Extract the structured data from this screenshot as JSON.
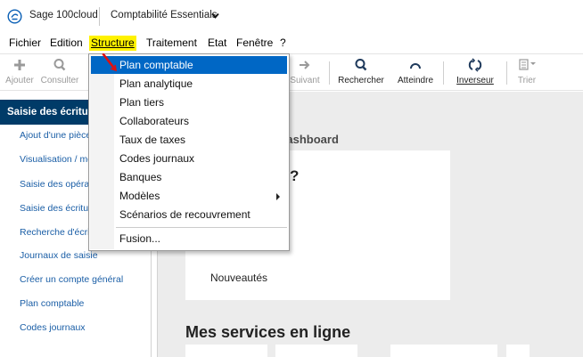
{
  "titlebar": {
    "app_name": "Sage 100cloud",
    "product": "Comptabilité Essentials",
    "logo_icon": "sage-logo-icon",
    "chevron_icon": "chevron-down-icon"
  },
  "menubar": {
    "items": [
      "Fichier",
      "Edition",
      "Structure",
      "Traitement",
      "Etat",
      "Fenêtre",
      "?"
    ],
    "active": "Structure",
    "active_color": "#fff200"
  },
  "toolbar": {
    "buttons": [
      {
        "label": "Ajouter",
        "icon": "plus-icon",
        "enabled": false
      },
      {
        "label": "Consulter",
        "icon": "search-icon",
        "enabled": false
      },
      {
        "label": "Suivant",
        "icon": "arrow-right-icon",
        "enabled": false
      },
      {
        "label": "Rechercher",
        "icon": "search-icon",
        "enabled": true
      },
      {
        "label": "Atteindre",
        "icon": "goto-icon",
        "enabled": true
      },
      {
        "label": "Inverseur",
        "icon": "refresh-icon",
        "enabled": true
      },
      {
        "label": "Trier",
        "icon": "sort-icon",
        "enabled": false
      }
    ]
  },
  "sidebar": {
    "header": "Saisie des écritures",
    "header_color": "#003b68",
    "links": [
      "Ajout d'une pièce",
      "Visualisation / modification",
      "Saisie des opérations",
      "Saisie des écritures",
      "Recherche d'écritures",
      "Journaux de saisie",
      "Créer un compte général",
      "Plan comptable",
      "Codes journaux"
    ],
    "link_color": "#1a5ea6"
  },
  "main": {
    "dashboard_title": "Dashboard",
    "card_heading": "?",
    "card_news": "Nouveautés",
    "section_title": "Mes services en ligne"
  },
  "dropdown": {
    "items": [
      {
        "label": "Plan comptable",
        "selected": true,
        "submenu": false
      },
      {
        "label": "Plan analytique",
        "selected": false,
        "submenu": false
      },
      {
        "label": "Plan tiers",
        "selected": false,
        "submenu": false
      },
      {
        "label": "Collaborateurs",
        "selected": false,
        "submenu": false
      },
      {
        "label": "Taux de taxes",
        "selected": false,
        "submenu": false
      },
      {
        "label": "Codes journaux",
        "selected": false,
        "submenu": false
      },
      {
        "label": "Banques",
        "selected": false,
        "submenu": false
      },
      {
        "label": "Modèles",
        "selected": false,
        "submenu": true
      },
      {
        "label": "Scénarios de recouvrement",
        "selected": false,
        "submenu": false
      },
      {
        "label": "Fusion...",
        "selected": false,
        "submenu": false
      }
    ],
    "selected_color": "#0067c5",
    "annotation_color": "#e01010"
  }
}
